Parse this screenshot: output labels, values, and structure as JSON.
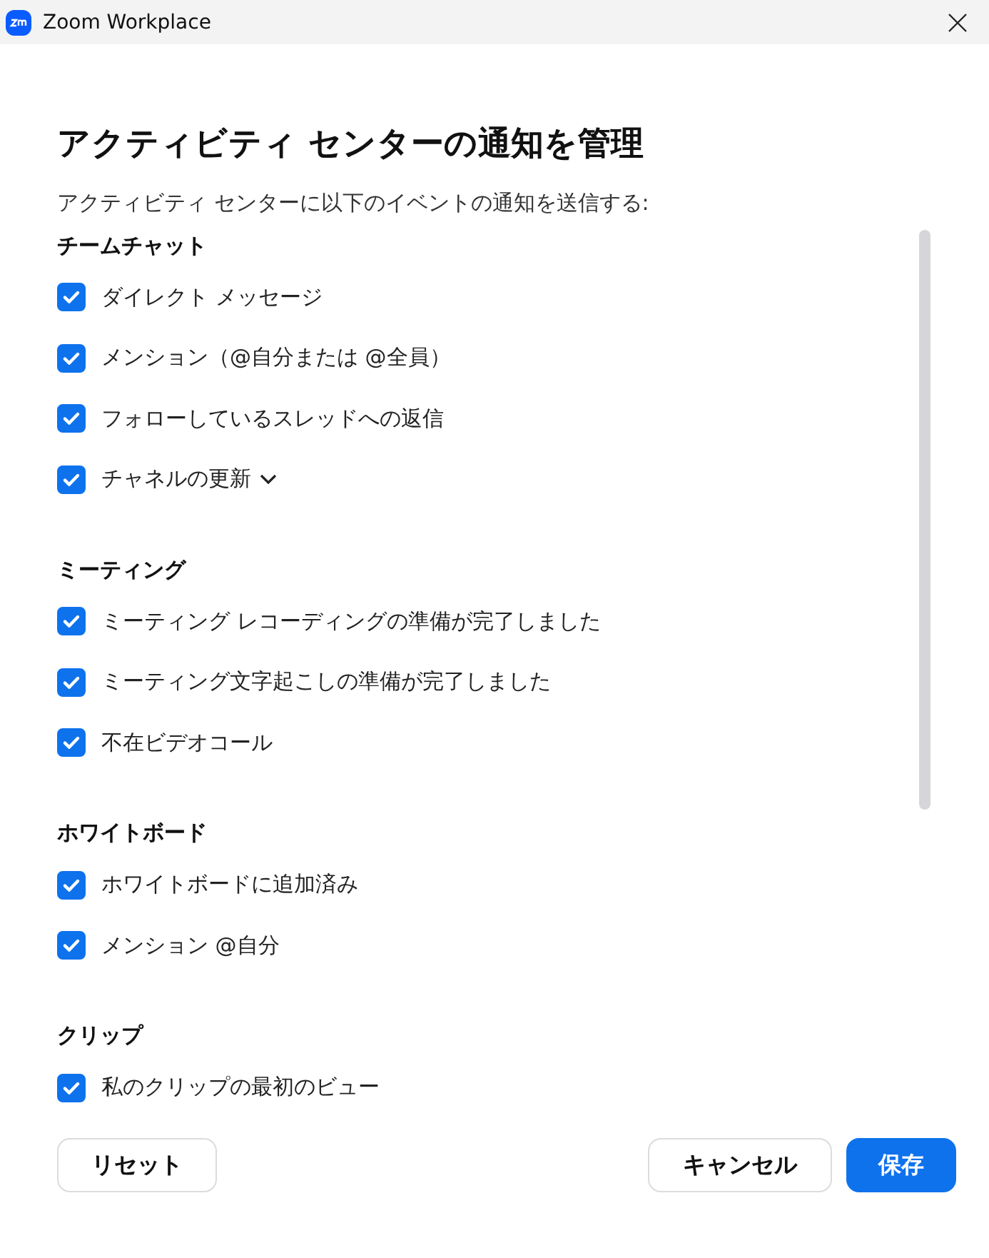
{
  "window": {
    "title": "Zoom Workplace"
  },
  "heading": "アクティビティ センターの通知を管理",
  "intro": "アクティビティ センターに以下のイベントの通知を送信する:",
  "sections": [
    {
      "title": "チームチャット",
      "items": [
        {
          "label": "ダイレクト メッセージ",
          "checked": true
        },
        {
          "label": "メンション（@自分または @全員）",
          "checked": true
        },
        {
          "label": "フォローしているスレッドへの返信",
          "checked": true
        },
        {
          "label": "チャネルの更新",
          "checked": true,
          "expanded": false
        }
      ]
    },
    {
      "title": "ミーティング",
      "items": [
        {
          "label": "ミーティング レコーディングの準備が完了しました",
          "checked": true
        },
        {
          "label": "ミーティング文字起こしの準備が完了しました",
          "checked": true
        },
        {
          "label": "不在ビデオコール",
          "checked": true
        }
      ]
    },
    {
      "title": "ホワイトボード",
      "items": [
        {
          "label": "ホワイトボードに追加済み",
          "checked": true
        },
        {
          "label": "メンション @自分",
          "checked": true
        }
      ]
    },
    {
      "title": "クリップ",
      "items": [
        {
          "label": "私のクリップの最初のビュー",
          "checked": true
        }
      ]
    }
  ],
  "buttons": {
    "reset": "リセット",
    "cancel": "キャンセル",
    "save": "保存"
  }
}
